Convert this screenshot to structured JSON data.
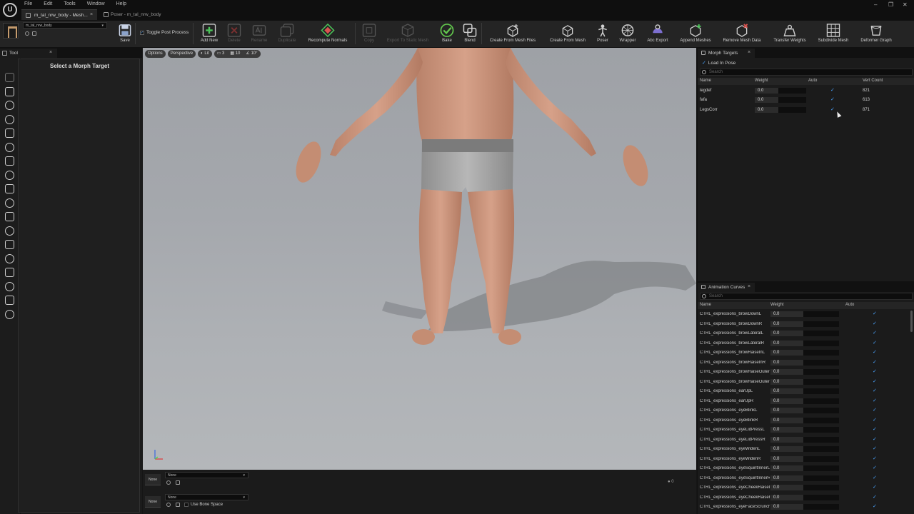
{
  "menu": [
    "File",
    "Edit",
    "Tools",
    "Window",
    "Help"
  ],
  "tabs": [
    {
      "label": "m_tal_nrw_body - Mesh...",
      "close": "×"
    },
    {
      "label": "Poser - m_tal_nrw_body"
    }
  ],
  "window_controls": [
    "–",
    "❐",
    "✕"
  ],
  "asset": {
    "name": "m_tal_nrw_body"
  },
  "toolbar": {
    "save": "Save",
    "toggle_post_process": "Toggle Post Process",
    "add_new": "Add New",
    "delete": "Delete",
    "rename": "Rename",
    "duplicate": "Duplicate",
    "recompute_normals": "Recompute Normals",
    "copy": "Copy",
    "export_static": "Export To Static Mesh",
    "bake": "Bake",
    "blend": "Blend",
    "create_from_mesh_files": "Create From Mesh Files",
    "create_from_mesh": "Create From Mesh",
    "poser": "Poser",
    "wrapper": "Wrapper",
    "abc_export": "Abc Export",
    "append_meshes": "Append Meshes",
    "remove_mesh_data": "Remove Mesh Data",
    "transfer_weights": "Transfer Weights",
    "subdivide_mesh": "Subdivide Mesh",
    "deformer_graph": "Deformer Graph"
  },
  "tool_panel": {
    "tab": "Tool",
    "close": "×",
    "message": "Select a Morph Target"
  },
  "viewport": {
    "options": "Options",
    "perspective": "Perspective",
    "lit": "Lit",
    "cam_speed": "3",
    "grid": "10",
    "angle": "10°"
  },
  "bottom": {
    "row1_chip": "None",
    "row1_select": "None",
    "row2_chip": "None",
    "row2_select": "None",
    "use_bone_space": "Use Bone Space",
    "frame": "0"
  },
  "morph_targets": {
    "tab": "Morph Targets",
    "close": "×",
    "load_in_pose": "Load In Pose",
    "search_placeholder": "Search",
    "columns": {
      "name": "Name",
      "weight": "Weight",
      "auto": "Auto",
      "vert_count": "Vert Count"
    },
    "rows": [
      {
        "name": "legdef",
        "weight": "0.0",
        "auto": true,
        "vert_count": "821"
      },
      {
        "name": "fafa",
        "weight": "0.0",
        "auto": true,
        "vert_count": "613"
      },
      {
        "name": "LegsCorr",
        "weight": "0.0",
        "auto": true,
        "vert_count": "871"
      }
    ]
  },
  "animation_curves": {
    "tab": "Animation Curves",
    "close": "×",
    "search_placeholder": "Search",
    "columns": {
      "name": "Name",
      "weight": "Weight",
      "auto": "Auto"
    },
    "rows": [
      {
        "name": "CTRL_expressions_browDownL",
        "weight": "0.0"
      },
      {
        "name": "CTRL_expressions_browDownR",
        "weight": "0.0"
      },
      {
        "name": "CTRL_expressions_browLateralL",
        "weight": "0.0"
      },
      {
        "name": "CTRL_expressions_browLateralR",
        "weight": "0.0"
      },
      {
        "name": "CTRL_expressions_browRaiseInL",
        "weight": "0.0"
      },
      {
        "name": "CTRL_expressions_browRaiseInR",
        "weight": "0.0"
      },
      {
        "name": "CTRL_expressions_browRaiseOuterL",
        "weight": "0.0"
      },
      {
        "name": "CTRL_expressions_browRaiseOuterR",
        "weight": "0.0"
      },
      {
        "name": "CTRL_expressions_earUpL",
        "weight": "0.0"
      },
      {
        "name": "CTRL_expressions_earUpR",
        "weight": "0.0"
      },
      {
        "name": "CTRL_expressions_eyeBlinkL",
        "weight": "0.0"
      },
      {
        "name": "CTRL_expressions_eyeBlinkR",
        "weight": "0.0"
      },
      {
        "name": "CTRL_expressions_eyeLidPressL",
        "weight": "0.0"
      },
      {
        "name": "CTRL_expressions_eyeLidPressR",
        "weight": "0.0"
      },
      {
        "name": "CTRL_expressions_eyeWidenL",
        "weight": "0.0"
      },
      {
        "name": "CTRL_expressions_eyeWidenR",
        "weight": "0.0"
      },
      {
        "name": "CTRL_expressions_eyeSquintInnerL",
        "weight": "0.0"
      },
      {
        "name": "CTRL_expressions_eyeSquintInnerR",
        "weight": "0.0"
      },
      {
        "name": "CTRL_expressions_eyeCheekRaiseL",
        "weight": "0.0"
      },
      {
        "name": "CTRL_expressions_eyeCheekRaiseR",
        "weight": "0.0"
      },
      {
        "name": "CTRL_expressions_eyeFaceScrunchL",
        "weight": "0.0"
      }
    ]
  },
  "colors": {
    "accent_check": "#4aa3ff",
    "add_new_green": "#4cc35a",
    "bake_green": "#62c84d"
  }
}
